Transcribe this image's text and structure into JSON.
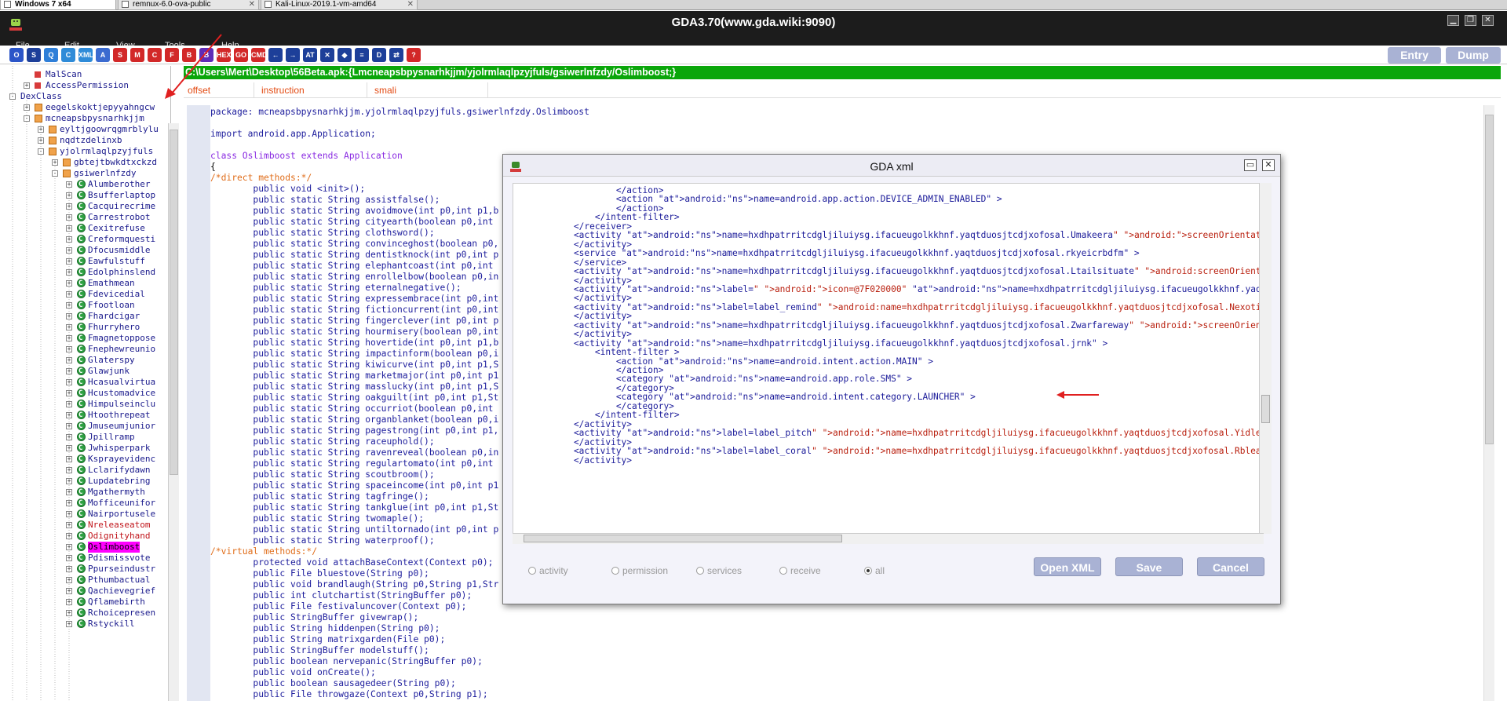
{
  "vm_tabs": [
    {
      "label": "Windows 7 x64"
    },
    {
      "label": "remnux-6.0-ova-public"
    },
    {
      "label": "Kali-Linux-2019.1-vm-amd64"
    }
  ],
  "app": {
    "title": "GDA3.70(www.gda.wiki:9090)",
    "menus": [
      "File",
      "Edit",
      "View",
      "Tools",
      "Help"
    ],
    "entry_label": "Entry",
    "dump_label": "Dump"
  },
  "toolbar": {
    "icons": [
      {
        "name": "open-icon",
        "glyph": "O",
        "color": "#2b55c8"
      },
      {
        "name": "save-icon",
        "glyph": "S",
        "color": "#1d3f99"
      },
      {
        "name": "search-icon",
        "glyph": "Q",
        "color": "#2f7fd8"
      },
      {
        "name": "class-icon",
        "glyph": "C",
        "color": "#2e8bd8"
      },
      {
        "name": "xml-icon",
        "glyph": "XML",
        "color": "#2e8bd8"
      },
      {
        "name": "android-icon",
        "glyph": "A",
        "color": "#3b6bd0"
      },
      {
        "name": "string-icon",
        "glyph": "S",
        "color": "#d22828"
      },
      {
        "name": "method-icon",
        "glyph": "M",
        "color": "#d22828"
      },
      {
        "name": "c-icon",
        "glyph": "C",
        "color": "#d22828"
      },
      {
        "name": "f-icon",
        "glyph": "F",
        "color": "#d22828"
      },
      {
        "name": "b-icon",
        "glyph": "B",
        "color": "#d22828"
      },
      {
        "name": "bookmark-icon",
        "glyph": "B",
        "color": "#5f2bb7"
      },
      {
        "name": "hex-icon",
        "glyph": "HEX",
        "color": "#d22828"
      },
      {
        "name": "goto-icon",
        "glyph": "GO",
        "color": "#d22828"
      },
      {
        "name": "cmd-icon",
        "glyph": "CMD",
        "color": "#d22828"
      },
      {
        "name": "back-icon",
        "glyph": "←",
        "color": "#1d3f99"
      },
      {
        "name": "forward-icon",
        "glyph": "→",
        "color": "#1d3f99"
      },
      {
        "name": "at-icon",
        "glyph": "AT",
        "color": "#1d3f99"
      },
      {
        "name": "tools-icon",
        "glyph": "✕",
        "color": "#1d3f99"
      },
      {
        "name": "code-icon",
        "glyph": "◆",
        "color": "#1d3f99"
      },
      {
        "name": "web-icon",
        "glyph": "≡",
        "color": "#1d3f99"
      },
      {
        "name": "dex-icon",
        "glyph": "D",
        "color": "#1d3f99"
      },
      {
        "name": "link-icon",
        "glyph": "⇄",
        "color": "#1d3f99"
      },
      {
        "name": "help-icon",
        "glyph": "?",
        "color": "#d22828"
      }
    ]
  },
  "tree": {
    "items": [
      {
        "label": "MalScan",
        "icon": "red",
        "indent": 1
      },
      {
        "label": "AccessPermission",
        "icon": "red",
        "indent": 1,
        "expander": "+"
      },
      {
        "label": "DexClass",
        "icon": "none",
        "indent": 0,
        "expander": "-"
      },
      {
        "label": "eegelskoktjepyyahngcw",
        "icon": "pkg",
        "indent": 1,
        "expander": "+"
      },
      {
        "label": "mcneapsbpysnarhkjjm",
        "icon": "pkg",
        "indent": 1,
        "expander": "-"
      },
      {
        "label": "eyltjgoowrqgmrblylu",
        "icon": "pkg",
        "indent": 2,
        "expander": "+"
      },
      {
        "label": "nqdtzdelinxb",
        "icon": "pkg",
        "indent": 2,
        "expander": "+"
      },
      {
        "label": "yjolrmlaqlpzyjfuls",
        "icon": "pkg",
        "indent": 2,
        "expander": "-"
      },
      {
        "label": "gbtejtbwkdtxckzd",
        "icon": "pkg",
        "indent": 3,
        "expander": "+"
      },
      {
        "label": "gsiwerlnfzdy",
        "icon": "pkg",
        "indent": 3,
        "expander": "-"
      },
      {
        "label": "Alumberother",
        "icon": "cls",
        "indent": 4,
        "expander": "+"
      },
      {
        "label": "Bsufferlaptop",
        "icon": "cls",
        "indent": 4,
        "expander": "+"
      },
      {
        "label": "Cacquirecrime",
        "icon": "cls",
        "indent": 4,
        "expander": "+"
      },
      {
        "label": "Carrestrobot",
        "icon": "cls",
        "indent": 4,
        "expander": "+"
      },
      {
        "label": "Cexitrefuse",
        "icon": "cls",
        "indent": 4,
        "expander": "+"
      },
      {
        "label": "Creformquesti",
        "icon": "cls",
        "indent": 4,
        "expander": "+"
      },
      {
        "label": "Dfocusmiddle",
        "icon": "cls",
        "indent": 4,
        "expander": "+"
      },
      {
        "label": "Eawfulstuff",
        "icon": "cls",
        "indent": 4,
        "expander": "+"
      },
      {
        "label": "Edolphinslend",
        "icon": "cls",
        "indent": 4,
        "expander": "+"
      },
      {
        "label": "Emathmean",
        "icon": "cls",
        "indent": 4,
        "expander": "+"
      },
      {
        "label": "Fdevicedial",
        "icon": "cls",
        "indent": 4,
        "expander": "+"
      },
      {
        "label": "Ffootloan",
        "icon": "cls",
        "indent": 4,
        "expander": "+"
      },
      {
        "label": "Fhardcigar",
        "icon": "cls",
        "indent": 4,
        "expander": "+"
      },
      {
        "label": "Fhurryhero",
        "icon": "cls",
        "indent": 4,
        "expander": "+"
      },
      {
        "label": "Fmagnetoppose",
        "icon": "cls",
        "indent": 4,
        "expander": "+"
      },
      {
        "label": "Fnephewreunio",
        "icon": "cls",
        "indent": 4,
        "expander": "+"
      },
      {
        "label": "Glaterspy",
        "icon": "cls",
        "indent": 4,
        "expander": "+"
      },
      {
        "label": "Glawjunk",
        "icon": "cls",
        "indent": 4,
        "expander": "+"
      },
      {
        "label": "Hcasualvirtua",
        "icon": "cls",
        "indent": 4,
        "expander": "+"
      },
      {
        "label": "Hcustomadvice",
        "icon": "cls",
        "indent": 4,
        "expander": "+"
      },
      {
        "label": "Himpulseinclu",
        "icon": "cls",
        "indent": 4,
        "expander": "+"
      },
      {
        "label": "Htoothrepeat",
        "icon": "cls",
        "indent": 4,
        "expander": "+"
      },
      {
        "label": "Jmuseumjunior",
        "icon": "cls",
        "indent": 4,
        "expander": "+"
      },
      {
        "label": "Jpillramp",
        "icon": "cls",
        "indent": 4,
        "expander": "+"
      },
      {
        "label": "Jwhisperpark",
        "icon": "cls",
        "indent": 4,
        "expander": "+"
      },
      {
        "label": "Ksprayevidenc",
        "icon": "cls",
        "indent": 4,
        "expander": "+"
      },
      {
        "label": "Lclarifydawn",
        "icon": "cls",
        "indent": 4,
        "expander": "+"
      },
      {
        "label": "Lupdatebring",
        "icon": "cls",
        "indent": 4,
        "expander": "+"
      },
      {
        "label": "Mgathermyth",
        "icon": "cls",
        "indent": 4,
        "expander": "+"
      },
      {
        "label": "Mofficeunifor",
        "icon": "cls",
        "indent": 4,
        "expander": "+"
      },
      {
        "label": "Nairportusele",
        "icon": "cls",
        "indent": 4,
        "expander": "+"
      },
      {
        "label": "Nreleaseatom",
        "icon": "cls",
        "indent": 4,
        "expander": "+",
        "red": true
      },
      {
        "label": "Odignityhand",
        "icon": "cls",
        "indent": 4,
        "expander": "+",
        "red": true
      },
      {
        "label": "Oslimboost",
        "icon": "cls",
        "indent": 4,
        "expander": "+",
        "selected": true
      },
      {
        "label": "Pdismissvote",
        "icon": "cls",
        "indent": 4,
        "expander": "+"
      },
      {
        "label": "Ppurseindustr",
        "icon": "cls",
        "indent": 4,
        "expander": "+"
      },
      {
        "label": "Pthumbactual",
        "icon": "cls",
        "indent": 4,
        "expander": "+"
      },
      {
        "label": "Qachievegrief",
        "icon": "cls",
        "indent": 4,
        "expander": "+"
      },
      {
        "label": "Qflamebirth",
        "icon": "cls",
        "indent": 4,
        "expander": "+"
      },
      {
        "label": "Rchoicepresen",
        "icon": "cls",
        "indent": 4,
        "expander": "+"
      },
      {
        "label": "Rstyckill",
        "icon": "cls",
        "indent": 4,
        "expander": "+"
      }
    ]
  },
  "path_bar": "C:\\Users\\Mert\\Desktop\\56Beta.apk:{Lmcneapsbpysnarhkjjm/yjolrmlaqlpzyjfuls/gsiwerlnfzdy/Oslimboost;}",
  "columns": [
    "offset",
    "instruction",
    "smali"
  ],
  "code": {
    "lines": [
      {
        "t": "package: mcneapsbpysnarhkjjm.yjolrmlaqlpzyjfuls.gsiwerlnfzdy.Oslimboost",
        "c": "pl"
      },
      {
        "t": "",
        "c": "nm"
      },
      {
        "t": "import android.app.Application;",
        "c": "pl"
      },
      {
        "t": "",
        "c": "nm"
      },
      {
        "t": "class Oslimboost extends Application",
        "c": "kw"
      },
      {
        "t": "{",
        "c": "nm"
      },
      {
        "t": "/*direct methods:*/",
        "c": "cm"
      },
      {
        "t": "        public void <init>();",
        "c": "pl"
      },
      {
        "t": "        public static String assistfalse();",
        "c": "pl"
      },
      {
        "t": "        public static String avoidmove(int p0,int p1,b",
        "c": "pl"
      },
      {
        "t": "        public static String cityearth(boolean p0,int",
        "c": "pl"
      },
      {
        "t": "        public static String clothsword();",
        "c": "pl"
      },
      {
        "t": "        public static String convinceghost(boolean p0,",
        "c": "pl"
      },
      {
        "t": "        public static String dentistknock(int p0,int p",
        "c": "pl"
      },
      {
        "t": "        public static String elephantcoast(int p0,int",
        "c": "pl"
      },
      {
        "t": "        public static String enrollelbow(boolean p0,in",
        "c": "pl"
      },
      {
        "t": "        public static String eternalnegative();",
        "c": "pl"
      },
      {
        "t": "        public static String expressembrace(int p0,int",
        "c": "pl"
      },
      {
        "t": "        public static String fictioncurrent(int p0,int",
        "c": "pl"
      },
      {
        "t": "        public static String fingerclever(int p0,int p",
        "c": "pl"
      },
      {
        "t": "        public static String hourmisery(boolean p0,int",
        "c": "pl"
      },
      {
        "t": "        public static String hovertide(int p0,int p1,b",
        "c": "pl"
      },
      {
        "t": "        public static String impactinform(boolean p0,i",
        "c": "pl"
      },
      {
        "t": "        public static String kiwicurve(int p0,int p1,S",
        "c": "pl"
      },
      {
        "t": "        public static String marketmajor(int p0,int p1",
        "c": "pl"
      },
      {
        "t": "        public static String masslucky(int p0,int p1,S",
        "c": "pl"
      },
      {
        "t": "        public static String oakguilt(int p0,int p1,St",
        "c": "pl"
      },
      {
        "t": "        public static String occurriot(boolean p0,int",
        "c": "pl"
      },
      {
        "t": "        public static String organblanket(boolean p0,i",
        "c": "pl"
      },
      {
        "t": "        public static String pagestrong(int p0,int p1,",
        "c": "pl"
      },
      {
        "t": "        public static String raceuphold();",
        "c": "pl"
      },
      {
        "t": "        public static String ravenreveal(boolean p0,in",
        "c": "pl"
      },
      {
        "t": "        public static String regulartomato(int p0,int",
        "c": "pl"
      },
      {
        "t": "        public static String scoutbroom();",
        "c": "pl"
      },
      {
        "t": "        public static String spaceincome(int p0,int p1",
        "c": "pl"
      },
      {
        "t": "        public static String tagfringe();",
        "c": "pl"
      },
      {
        "t": "        public static String tankglue(int p0,int p1,St",
        "c": "pl"
      },
      {
        "t": "        public static String twomaple();",
        "c": "pl"
      },
      {
        "t": "        public static String untiltornado(int p0,int p",
        "c": "pl"
      },
      {
        "t": "        public static String waterproof();",
        "c": "pl"
      },
      {
        "t": "/*virtual methods:*/",
        "c": "cm"
      },
      {
        "t": "        protected void attachBaseContext(Context p0);",
        "c": "pl"
      },
      {
        "t": "        public File bluestove(String p0);",
        "c": "pl"
      },
      {
        "t": "        public void brandlaugh(String p0,String p1,Str",
        "c": "pl"
      },
      {
        "t": "        public int clutchartist(StringBuffer p0);",
        "c": "pl"
      },
      {
        "t": "        public File festivaluncover(Context p0);",
        "c": "pl"
      },
      {
        "t": "        public StringBuffer givewrap();",
        "c": "pl"
      },
      {
        "t": "        public String hiddenpen(String p0);",
        "c": "pl"
      },
      {
        "t": "        public String matrixgarden(File p0);",
        "c": "pl"
      },
      {
        "t": "        public StringBuffer modelstuff();",
        "c": "pl"
      },
      {
        "t": "        public boolean nervepanic(StringBuffer p0);",
        "c": "pl"
      },
      {
        "t": "        public void onCreate();",
        "c": "pl"
      },
      {
        "t": "        public boolean sausagedeer(String p0);",
        "c": "pl"
      },
      {
        "t": "        public File throwgaze(Context p0,String p1);",
        "c": "pl"
      }
    ]
  },
  "dialog": {
    "title": "GDA xml",
    "xml_lines": [
      "            </action>",
      "            <action android:name=\"android.app.action.DEVICE_ADMIN_ENABLED\" >",
      "            </action>",
      "        </intent-filter>",
      "    </receiver>",
      "    <activity android:name=\"hxdhpatrritcdgljiluiysg.ifacueugolkkhnf.yaqtduosjtcdjxofosal.Umakeera\" android:screenOrientation=\"1\" >",
      "    </activity>",
      "    <service android:name=\"hxdhpatrritcdgljiluiysg.ifacueugolkkhnf.yaqtduosjtcdjxofosal.rkyeicrbdfm\" >",
      "    </service>",
      "    <activity android:name=\"hxdhpatrritcdgljiluiysg.ifacueugolkkhnf.yaqtduosjtcdjxofosal.Ltailsituate\" android:screenOrientation=\"1",
      "    </activity>",
      "    <activity android:label=\"\" android:icon=\"@7F020000\" android:name=\"hxdhpatrritcdgljiluiysg.ifacueugolkkhnf.yaqtduosjtcdjxofosal.",
      "    </activity>",
      "    <activity android:label=\"label_remind\" android:name=\"hxdhpatrritcdgljiluiysg.ifacueugolkkhnf.yaqtduosjtcdjxofosal.Nexoticsuspec",
      "    </activity>",
      "    <activity android:name=\"hxdhpatrritcdgljiluiysg.ifacueugolkkhnf.yaqtduosjtcdjxofosal.Zwarfareway\" android:screenOrientation=\"0\"",
      "    </activity>",
      "    <activity android:name=\"hxdhpatrritcdgljiluiysg.ifacueugolkkhnf.yaqtduosjtcdjxofosal.jrnk\" >",
      "        <intent-filter >",
      "            <action android:name=\"android.intent.action.MAIN\" >",
      "            </action>",
      "            <category android:name=\"android.app.role.SMS\" >",
      "            </category>",
      "            <category android:name=\"android.intent.category.LAUNCHER\" >",
      "            </category>",
      "        </intent-filter>",
      "    </activity>",
      "    <activity android:label=\"label_pitch\" android:name=\"hxdhpatrritcdgljiluiysg.ifacueugolkkhnf.yaqtduosjtcdjxofosal.Yidleload\" >",
      "    </activity>",
      "    <activity android:label=\"label_coral\" android:name=\"hxdhpatrritcdgljiluiysg.ifacueugolkkhnf.yaqtduosjtcdjxofosal.Rbleakdemand\"",
      "    </activity>"
    ],
    "filters": [
      {
        "label": "activity",
        "checked": false
      },
      {
        "label": "permission",
        "checked": false
      },
      {
        "label": "services",
        "checked": false
      },
      {
        "label": "receive",
        "checked": false
      },
      {
        "label": "all",
        "checked": true
      }
    ],
    "open_xml_label": "Open XML",
    "save_label": "Save",
    "cancel_label": "Cancel"
  },
  "colors": {
    "path_bar": "#0aa60a",
    "selected_item": "#ff00ff",
    "annotation_arrow": "#e02020",
    "button": "#a9b2d4"
  }
}
